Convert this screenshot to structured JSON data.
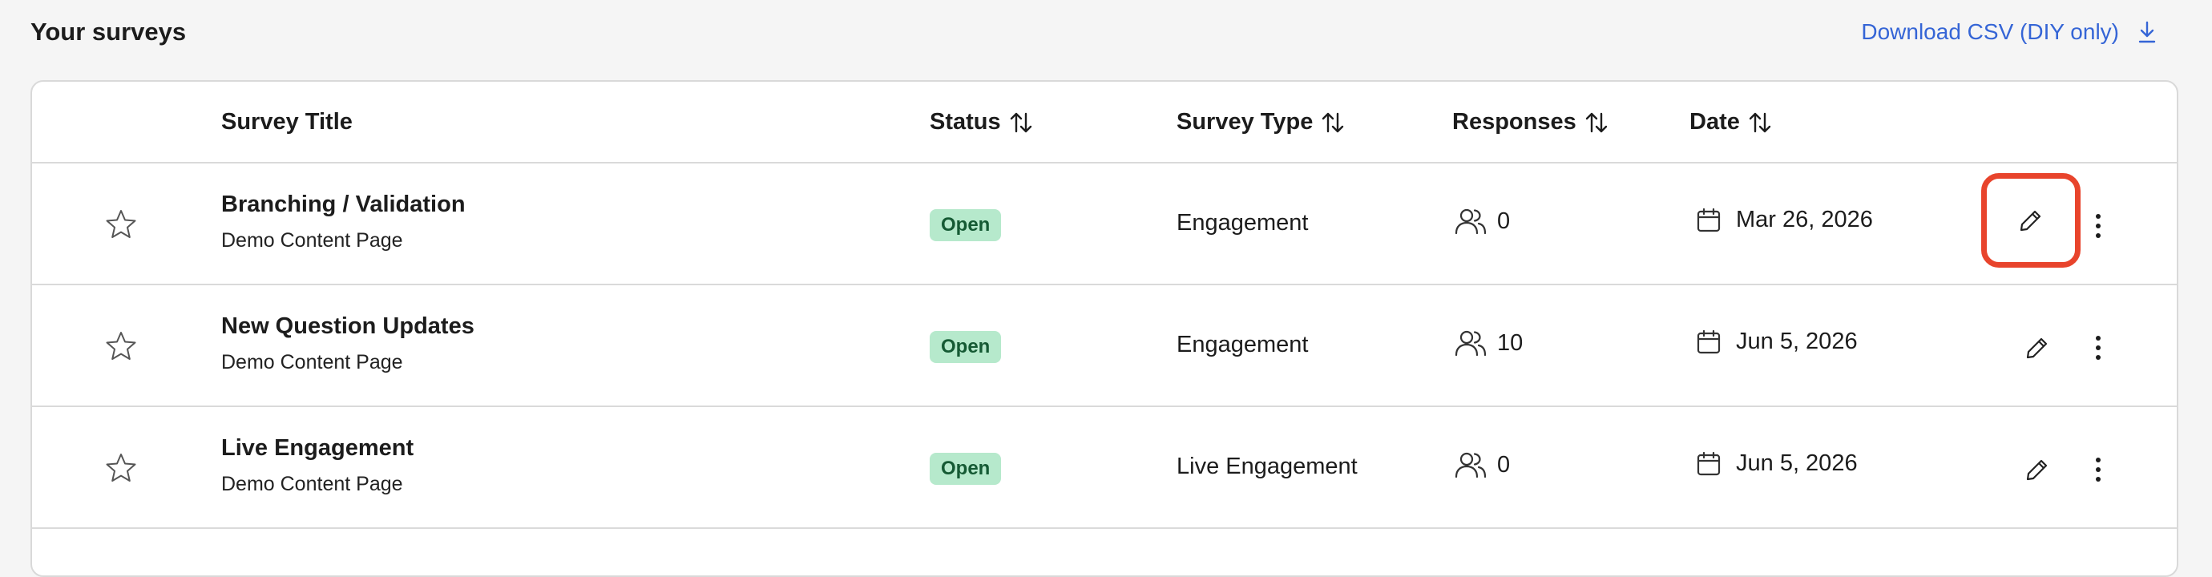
{
  "header": {
    "title": "Your surveys",
    "download_label": "Download CSV (DIY only)"
  },
  "table": {
    "columns": {
      "title": "Survey Title",
      "status": "Status",
      "type": "Survey Type",
      "responses": "Responses",
      "date": "Date"
    },
    "rows": [
      {
        "title": "Branching / Validation",
        "subtitle": "Demo Content Page",
        "status": "Open",
        "type": "Engagement",
        "responses": "0",
        "date": "Mar 26, 2026"
      },
      {
        "title": "New Question Updates",
        "subtitle": "Demo Content Page",
        "status": "Open",
        "type": "Engagement",
        "responses": "10",
        "date": "Jun 5, 2026"
      },
      {
        "title": "Live Engagement",
        "subtitle": "Demo Content Page",
        "status": "Open",
        "type": "Live Engagement",
        "responses": "0",
        "date": "Jun 5, 2026"
      }
    ]
  },
  "colors": {
    "link": "#3565d6",
    "status_open_bg": "#b6e9cc",
    "status_open_text": "#155a34",
    "highlight": "#e8442c"
  },
  "icons": {
    "download": "download-icon",
    "sort": "sort-icon",
    "star": "star-icon",
    "users": "users-icon",
    "calendar": "calendar-icon",
    "edit": "pencil-icon",
    "more": "more-vertical-icon"
  }
}
